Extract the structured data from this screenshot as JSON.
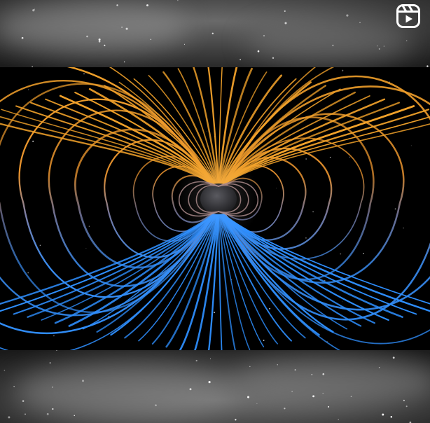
{
  "scene": {
    "subject": "magnetic-field-lines",
    "north_color": "#f2a22a",
    "south_color": "#2e8fff",
    "mid_color": "#7d7fa8",
    "planet_color": "#3a3a3f",
    "space_color": "#000000",
    "backdrop_color": "#3b3b3b"
  },
  "overlay": {
    "icon": "reels-icon"
  }
}
